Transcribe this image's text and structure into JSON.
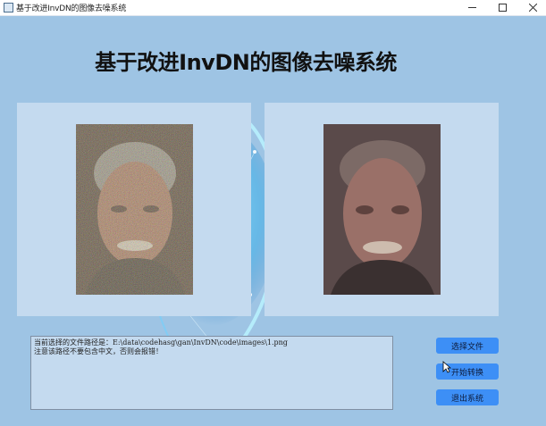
{
  "window": {
    "title": "基于改进InvDN的图像去噪系统"
  },
  "header": {
    "title": "基于改进InvDN的图像去噪系统"
  },
  "log": {
    "line1": "当前选择的文件路径是：E:\\data\\codehasg\\gan\\InvDN\\code\\images\\1.png",
    "line2": "注意该路径不要包含中文，否则会报错！"
  },
  "buttons": {
    "select_file": "选择文件",
    "start_convert": "开始转换",
    "exit_system": "退出系统"
  },
  "colors": {
    "background": "#9ec4e4",
    "panel": "#c4daef",
    "button": "#3d8ff6"
  }
}
